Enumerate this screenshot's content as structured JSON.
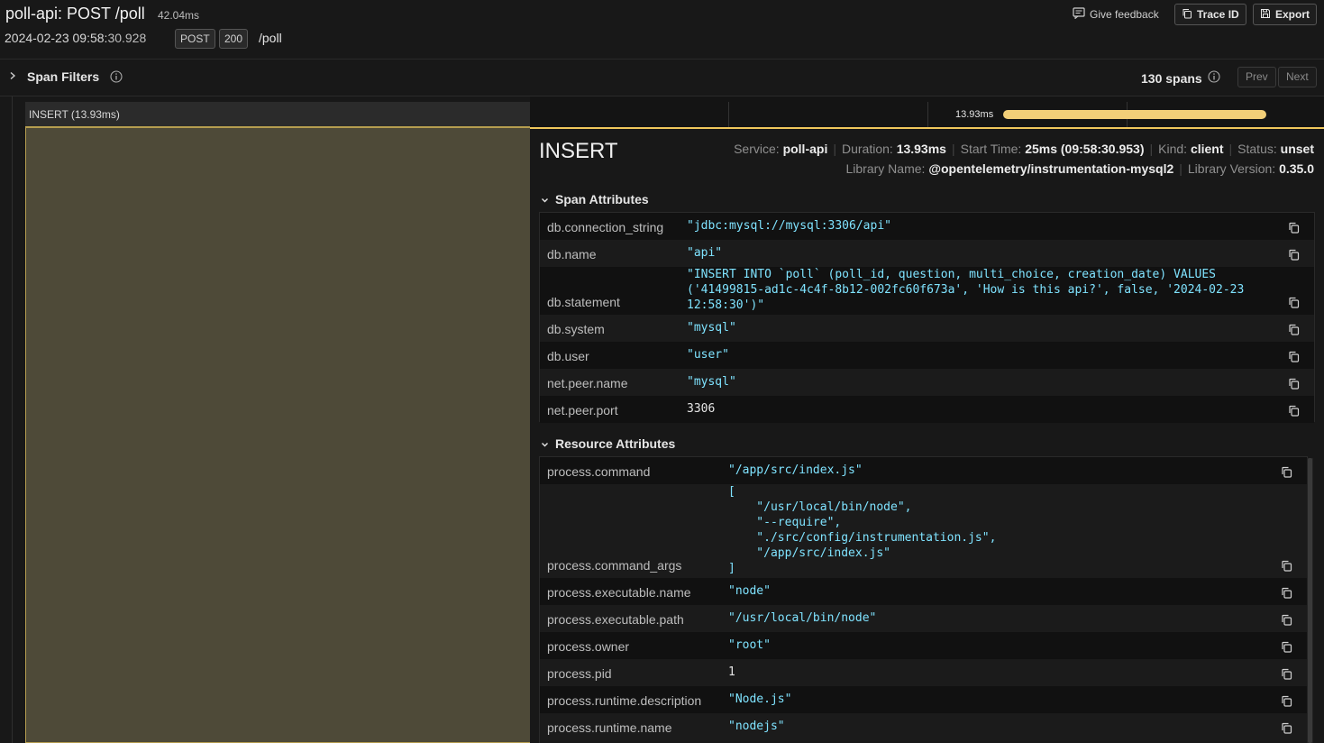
{
  "header": {
    "title": "poll-api: POST /poll",
    "duration": "42.04ms",
    "timestamp_main": "2024-02-23 09:58:",
    "timestamp_secs": "30.928",
    "method": "POST",
    "status_code": "200",
    "route": "/poll",
    "feedback_label": "Give feedback",
    "trace_id_label": "Trace ID",
    "export_label": "Export"
  },
  "filters": {
    "label": "Span Filters",
    "span_count": "130 spans",
    "prev_label": "Prev",
    "next_label": "Next"
  },
  "waterfall": {
    "selected_row_label": "INSERT (13.93ms)",
    "bar_label": "13.93ms",
    "bar_color": "#f2cf78"
  },
  "span": {
    "name": "INSERT",
    "service_label": "Service:",
    "service": "poll-api",
    "duration_label": "Duration:",
    "duration": "13.93ms",
    "start_label": "Start Time:",
    "start": "25ms (09:58:30.953)",
    "kind_label": "Kind:",
    "kind": "client",
    "status_label": "Status:",
    "status": "unset",
    "library_name_label": "Library Name:",
    "library_name": "@opentelemetry/instrumentation-mysql2",
    "library_version_label": "Library Version:",
    "library_version": "0.35.0"
  },
  "span_attributes": {
    "title": "Span Attributes",
    "rows": [
      {
        "key": "db.connection_string",
        "value": "\"jdbc:mysql://mysql:3306/api\""
      },
      {
        "key": "db.name",
        "value": "\"api\""
      },
      {
        "key": "db.statement",
        "value": "\"INSERT INTO `poll` (poll_id, question, multi_choice, creation_date) VALUES\n('41499815-ad1c-4c4f-8b12-002fc60f673a', 'How is this api?', false, '2024-02-23\n12:58:30')\""
      },
      {
        "key": "db.system",
        "value": "\"mysql\""
      },
      {
        "key": "db.user",
        "value": "\"user\""
      },
      {
        "key": "net.peer.name",
        "value": "\"mysql\""
      },
      {
        "key": "net.peer.port",
        "value": "3306"
      }
    ]
  },
  "resource_attributes": {
    "title": "Resource Attributes",
    "rows": [
      {
        "key": "process.command",
        "value": "\"/app/src/index.js\""
      },
      {
        "key": "process.command_args",
        "value": "[\n    \"/usr/local/bin/node\",\n    \"--require\",\n    \"./src/config/instrumentation.js\",\n    \"/app/src/index.js\"\n]"
      },
      {
        "key": "process.executable.name",
        "value": "\"node\""
      },
      {
        "key": "process.executable.path",
        "value": "\"/usr/local/bin/node\""
      },
      {
        "key": "process.owner",
        "value": "\"root\""
      },
      {
        "key": "process.pid",
        "value": "1"
      },
      {
        "key": "process.runtime.description",
        "value": "\"Node.js\""
      },
      {
        "key": "process.runtime.name",
        "value": "\"nodejs\""
      }
    ]
  },
  "colors": {
    "accent": "#f0c85c",
    "value_text": "#7fe3ff",
    "selected_bg": "#4e4a38"
  },
  "icons": {
    "feedback": "chat-bubble-icon",
    "trace_id": "copy-icon",
    "export": "save-icon",
    "info": "info-circle-icon",
    "copy": "copy-icon",
    "chevron": "chevron-down-icon"
  }
}
